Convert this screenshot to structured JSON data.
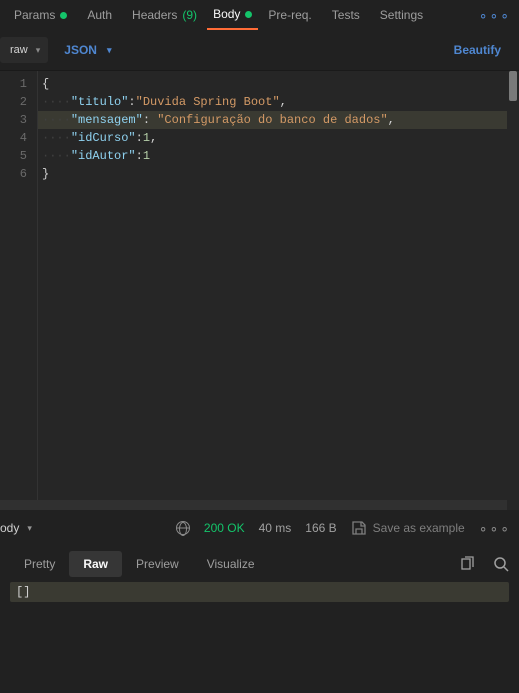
{
  "tabs": {
    "items": [
      {
        "label": "Params",
        "dot": true
      },
      {
        "label": "Auth",
        "dot": false
      },
      {
        "label": "Headers",
        "badge": "(9)"
      },
      {
        "label": "Body",
        "dot": true,
        "active": true
      },
      {
        "label": "Pre-req.",
        "dot": false
      },
      {
        "label": "Tests",
        "dot": false
      },
      {
        "label": "Settings",
        "dot": false
      }
    ]
  },
  "body_bar": {
    "mode": "raw",
    "lang": "JSON",
    "beautify": "Beautify"
  },
  "editor": {
    "lines": [
      {
        "n": "1",
        "t": "{",
        "cls": "punct"
      },
      {
        "n": "2",
        "k": "\"titulo\"",
        "v": "\"Duvida Spring Boot\"",
        "vt": "str",
        "comma": true
      },
      {
        "n": "3",
        "k": "\"mensagem\"",
        "v": "\"Configuração do banco de dados\"",
        "vt": "str",
        "comma": true,
        "hl": true,
        "space_after_colon": true
      },
      {
        "n": "4",
        "k": "\"idCurso\"",
        "v": "1",
        "vt": "num",
        "comma": true
      },
      {
        "n": "5",
        "k": "\"idAutor\"",
        "v": "1",
        "vt": "num",
        "comma": false
      },
      {
        "n": "6",
        "t": "}",
        "cls": "punct"
      }
    ]
  },
  "response": {
    "label": "ody",
    "status": "200 OK",
    "time": "40 ms",
    "size": "166 B",
    "save": "Save as example",
    "views": [
      "Pretty",
      "Raw",
      "Preview",
      "Visualize"
    ],
    "active_view": "Raw",
    "body": "[]"
  }
}
